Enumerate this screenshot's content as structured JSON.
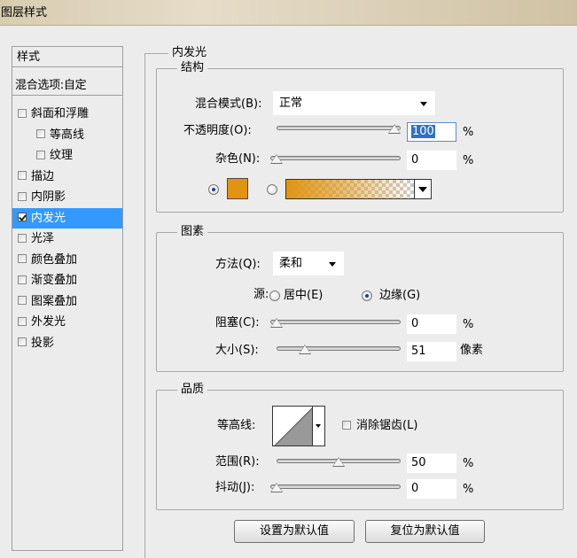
{
  "window": {
    "title": "图层样式"
  },
  "sidebar": {
    "header": "样式",
    "blend_options": "混合选项:自定",
    "items": [
      {
        "label": "斜面和浮雕",
        "checked": false,
        "indent": false
      },
      {
        "label": "等高线",
        "checked": false,
        "indent": true
      },
      {
        "label": "纹理",
        "checked": false,
        "indent": true
      },
      {
        "label": "描边",
        "checked": false,
        "indent": false
      },
      {
        "label": "内阴影",
        "checked": false,
        "indent": false
      },
      {
        "label": "内发光",
        "checked": true,
        "indent": false,
        "selected": true
      },
      {
        "label": "光泽",
        "checked": false,
        "indent": false
      },
      {
        "label": "颜色叠加",
        "checked": false,
        "indent": false
      },
      {
        "label": "渐变叠加",
        "checked": false,
        "indent": false
      },
      {
        "label": "图案叠加",
        "checked": false,
        "indent": false
      },
      {
        "label": "外发光",
        "checked": false,
        "indent": false
      },
      {
        "label": "投影",
        "checked": false,
        "indent": false
      }
    ]
  },
  "inner_glow": {
    "title": "内发光",
    "structure": {
      "title": "结构",
      "blend_mode_label": "混合模式",
      "blend_mode_key": "(B)",
      "blend_mode_value": "正常",
      "opacity_label": "不透明度",
      "opacity_key": "(O)",
      "opacity_value": "100",
      "opacity_fraction": 1.0,
      "noise_label": "杂色",
      "noise_key": "(N)",
      "noise_value": "0",
      "noise_fraction": 0.0,
      "percent": "%",
      "color": "#e0940f",
      "color_mode": "solid"
    },
    "elements": {
      "title": "图素",
      "method_label": "方法",
      "method_key": "(Q)",
      "method_value": "柔和",
      "source_label": "源",
      "source_center": "居中",
      "source_center_key": "(E)",
      "source_edge": "边缘",
      "source_edge_key": "(G)",
      "choke_label": "阻塞",
      "choke_key": "(C)",
      "choke_value": "0",
      "choke_fraction": 0.0,
      "size_label": "大小",
      "size_key": "(S)",
      "size_value": "51",
      "size_fraction": 0.2,
      "percent": "%",
      "pixels": "像素"
    },
    "quality": {
      "title": "品质",
      "contour_label": "等高线",
      "antialias_label": "消除锯齿",
      "antialias_key": "(L)",
      "antialias_checked": false,
      "range_label": "范围",
      "range_key": "(R)",
      "range_value": "50",
      "range_fraction": 0.5,
      "jitter_label": "抖动",
      "jitter_key": "(J)",
      "jitter_value": "0",
      "jitter_fraction": 0.0,
      "percent": "%"
    },
    "buttons": {
      "set_default": "设置为默认值",
      "reset_default": "复位为默认值"
    }
  }
}
